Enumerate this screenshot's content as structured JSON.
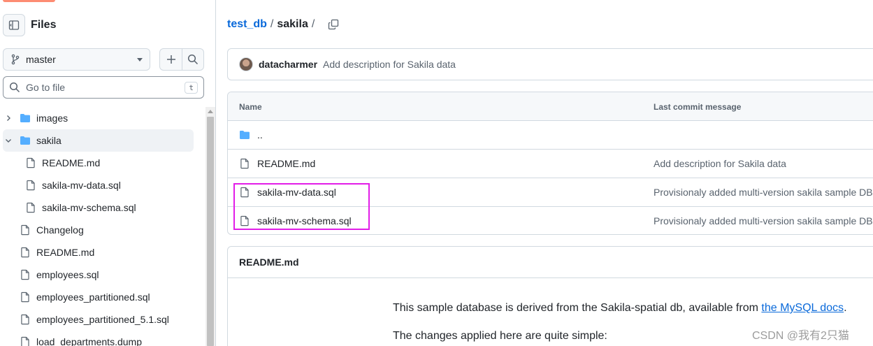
{
  "sidebar": {
    "title": "Files",
    "branch": "master",
    "goto_placeholder": "Go to file",
    "goto_shortcut": "t",
    "tree": [
      {
        "label": "images",
        "type": "folder",
        "expanded": false,
        "depth": 0
      },
      {
        "label": "sakila",
        "type": "folder",
        "expanded": true,
        "depth": 0,
        "active": true
      },
      {
        "label": "README.md",
        "type": "file",
        "depth": 1
      },
      {
        "label": "sakila-mv-data.sql",
        "type": "file",
        "depth": 1
      },
      {
        "label": "sakila-mv-schema.sql",
        "type": "file",
        "depth": 1
      },
      {
        "label": "Changelog",
        "type": "file",
        "depth": 0
      },
      {
        "label": "README.md",
        "type": "file",
        "depth": 0
      },
      {
        "label": "employees.sql",
        "type": "file",
        "depth": 0
      },
      {
        "label": "employees_partitioned.sql",
        "type": "file",
        "depth": 0
      },
      {
        "label": "employees_partitioned_5.1.sql",
        "type": "file",
        "depth": 0
      },
      {
        "label": "load_departments.dump",
        "type": "file",
        "depth": 0
      }
    ]
  },
  "breadcrumb": {
    "repo": "test_db",
    "sep1": "/",
    "current": "sakila",
    "sep2": "/"
  },
  "commit": {
    "author": "datacharmer",
    "message": "Add description for Sakila data"
  },
  "file_table": {
    "col_name": "Name",
    "col_message": "Last commit message",
    "rows": [
      {
        "name": "..",
        "type": "folder",
        "message": ""
      },
      {
        "name": "README.md",
        "type": "file",
        "message": "Add description for Sakila data"
      },
      {
        "name": "sakila-mv-data.sql",
        "type": "file",
        "message": "Provisionaly added multi-version sakila sample DB"
      },
      {
        "name": "sakila-mv-schema.sql",
        "type": "file",
        "message": "Provisionaly added multi-version sakila sample DB"
      }
    ]
  },
  "readme": {
    "title": "README.md",
    "line1_prefix": "This sample database is derived from the Sakila-spatial db, available from ",
    "line1_link": "the MySQL docs",
    "line1_suffix": ".",
    "line2": "The changes applied here are quite simple:"
  },
  "watermark": "CSDN @我有2只猫",
  "colors": {
    "accent_link": "#0969da",
    "highlight_box": "#e21de8",
    "folder_icon": "#54aeff"
  }
}
